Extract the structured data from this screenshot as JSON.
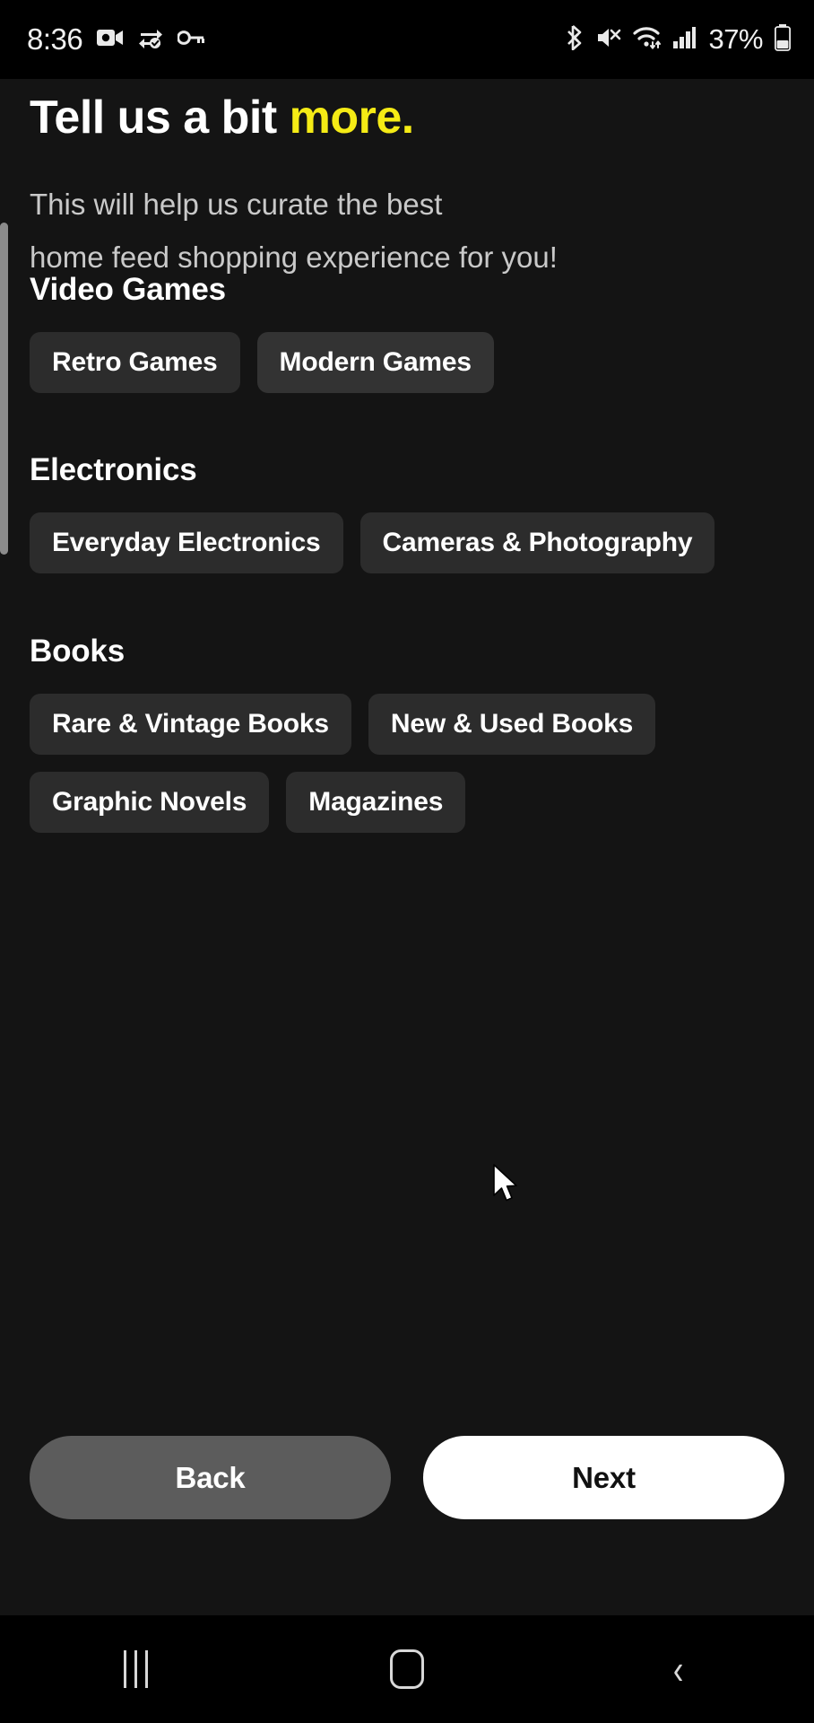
{
  "status_bar": {
    "time": "8:36",
    "battery_percent": "37%",
    "left_icons": [
      "video-camera-icon",
      "vpn-sync-icon",
      "key-icon"
    ],
    "right_icons": [
      "bluetooth-icon",
      "mute-icon",
      "wifi-icon",
      "signal-icon",
      "battery-icon"
    ]
  },
  "screen": {
    "headline_plain": "Tell us a bit ",
    "headline_accent": "more.",
    "accent_color": "#f5eb15",
    "subtitle_line1": "This will help us curate the best",
    "subtitle_line2": "home feed shopping experience for you!"
  },
  "sections": [
    {
      "title": "Video Games",
      "chips": [
        {
          "label": "Retro Games",
          "selected": false
        },
        {
          "label": "Modern Games",
          "selected": true
        }
      ]
    },
    {
      "title": "Electronics",
      "chips": [
        {
          "label": "Everyday Electronics",
          "selected": false
        },
        {
          "label": "Cameras & Photography",
          "selected": false
        }
      ]
    },
    {
      "title": "Books",
      "chips": [
        {
          "label": "Rare & Vintage Books",
          "selected": false
        },
        {
          "label": "New & Used Books",
          "selected": false
        },
        {
          "label": "Graphic Novels",
          "selected": false
        },
        {
          "label": "Magazines",
          "selected": false
        }
      ]
    }
  ],
  "actions": {
    "back_label": "Back",
    "next_label": "Next"
  },
  "nav_bar": {
    "recents_label": "recents",
    "home_label": "home",
    "back_label": "back",
    "back_glyph": "‹"
  }
}
